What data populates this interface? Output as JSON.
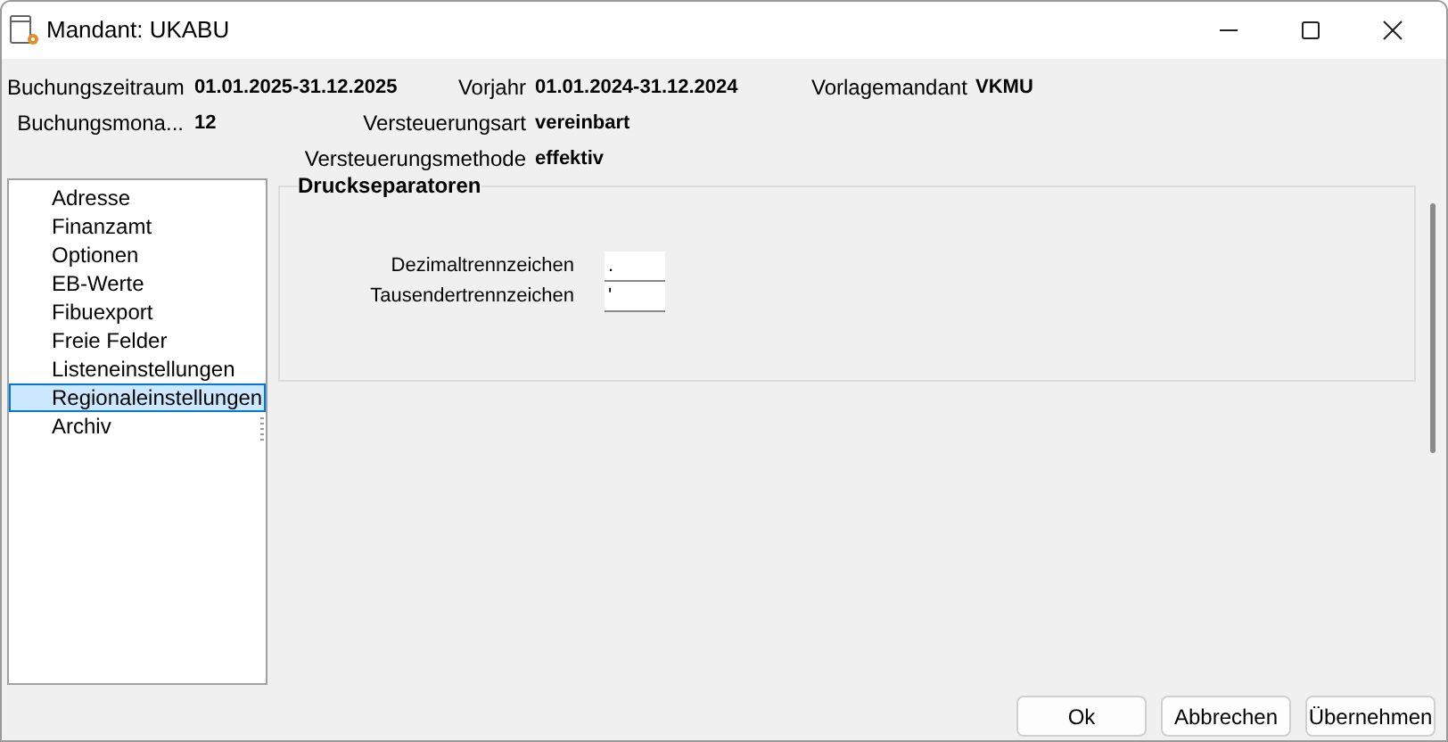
{
  "window": {
    "title": "Mandant: UKABU"
  },
  "header": [
    {
      "label": "Buchungszeitraum",
      "value": "01.01.2025-31.12.2025"
    },
    {
      "label": "Vorjahr",
      "value": "01.01.2024-31.12.2024"
    },
    {
      "label": "Vorlagemandant",
      "value": "VKMU"
    },
    {
      "label": "Buchungsmona...",
      "value": "12"
    },
    {
      "label": "Versteuerungsart",
      "value": "vereinbart"
    },
    {
      "label": "Versteuerungsmethode",
      "value": "effektiv"
    }
  ],
  "sidebar": {
    "items": [
      {
        "label": "Adresse",
        "selected": false
      },
      {
        "label": "Finanzamt",
        "selected": false
      },
      {
        "label": "Optionen",
        "selected": false
      },
      {
        "label": "EB-Werte",
        "selected": false
      },
      {
        "label": "Fibuexport",
        "selected": false
      },
      {
        "label": "Freie Felder",
        "selected": false
      },
      {
        "label": "Listeneinstellungen",
        "selected": false
      },
      {
        "label": "Regionaleinstellungen",
        "selected": true
      },
      {
        "label": "Archiv",
        "selected": false
      }
    ]
  },
  "group": {
    "title": "Druckseparatoren",
    "fields": [
      {
        "label": "Dezimaltrennzeichen",
        "value": "."
      },
      {
        "label": "Tausendertrennzeichen",
        "value": "'"
      }
    ]
  },
  "buttons": [
    "Ok",
    "Abbrechen",
    "Übernehmen"
  ]
}
